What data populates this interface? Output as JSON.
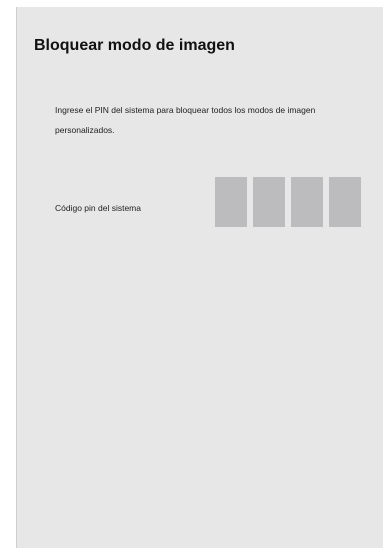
{
  "dialog": {
    "title": "Bloquear modo de imagen",
    "description": "Ingrese el PIN del sistema para bloquear todos los modos de imagen personalizados.",
    "pin_label": "Código pin del sistema",
    "pin_digits": [
      "",
      "",
      "",
      ""
    ]
  },
  "colors": {
    "panel_background": "#e7e7e7",
    "pin_box": "#bcbcbe",
    "text": "#222222"
  }
}
